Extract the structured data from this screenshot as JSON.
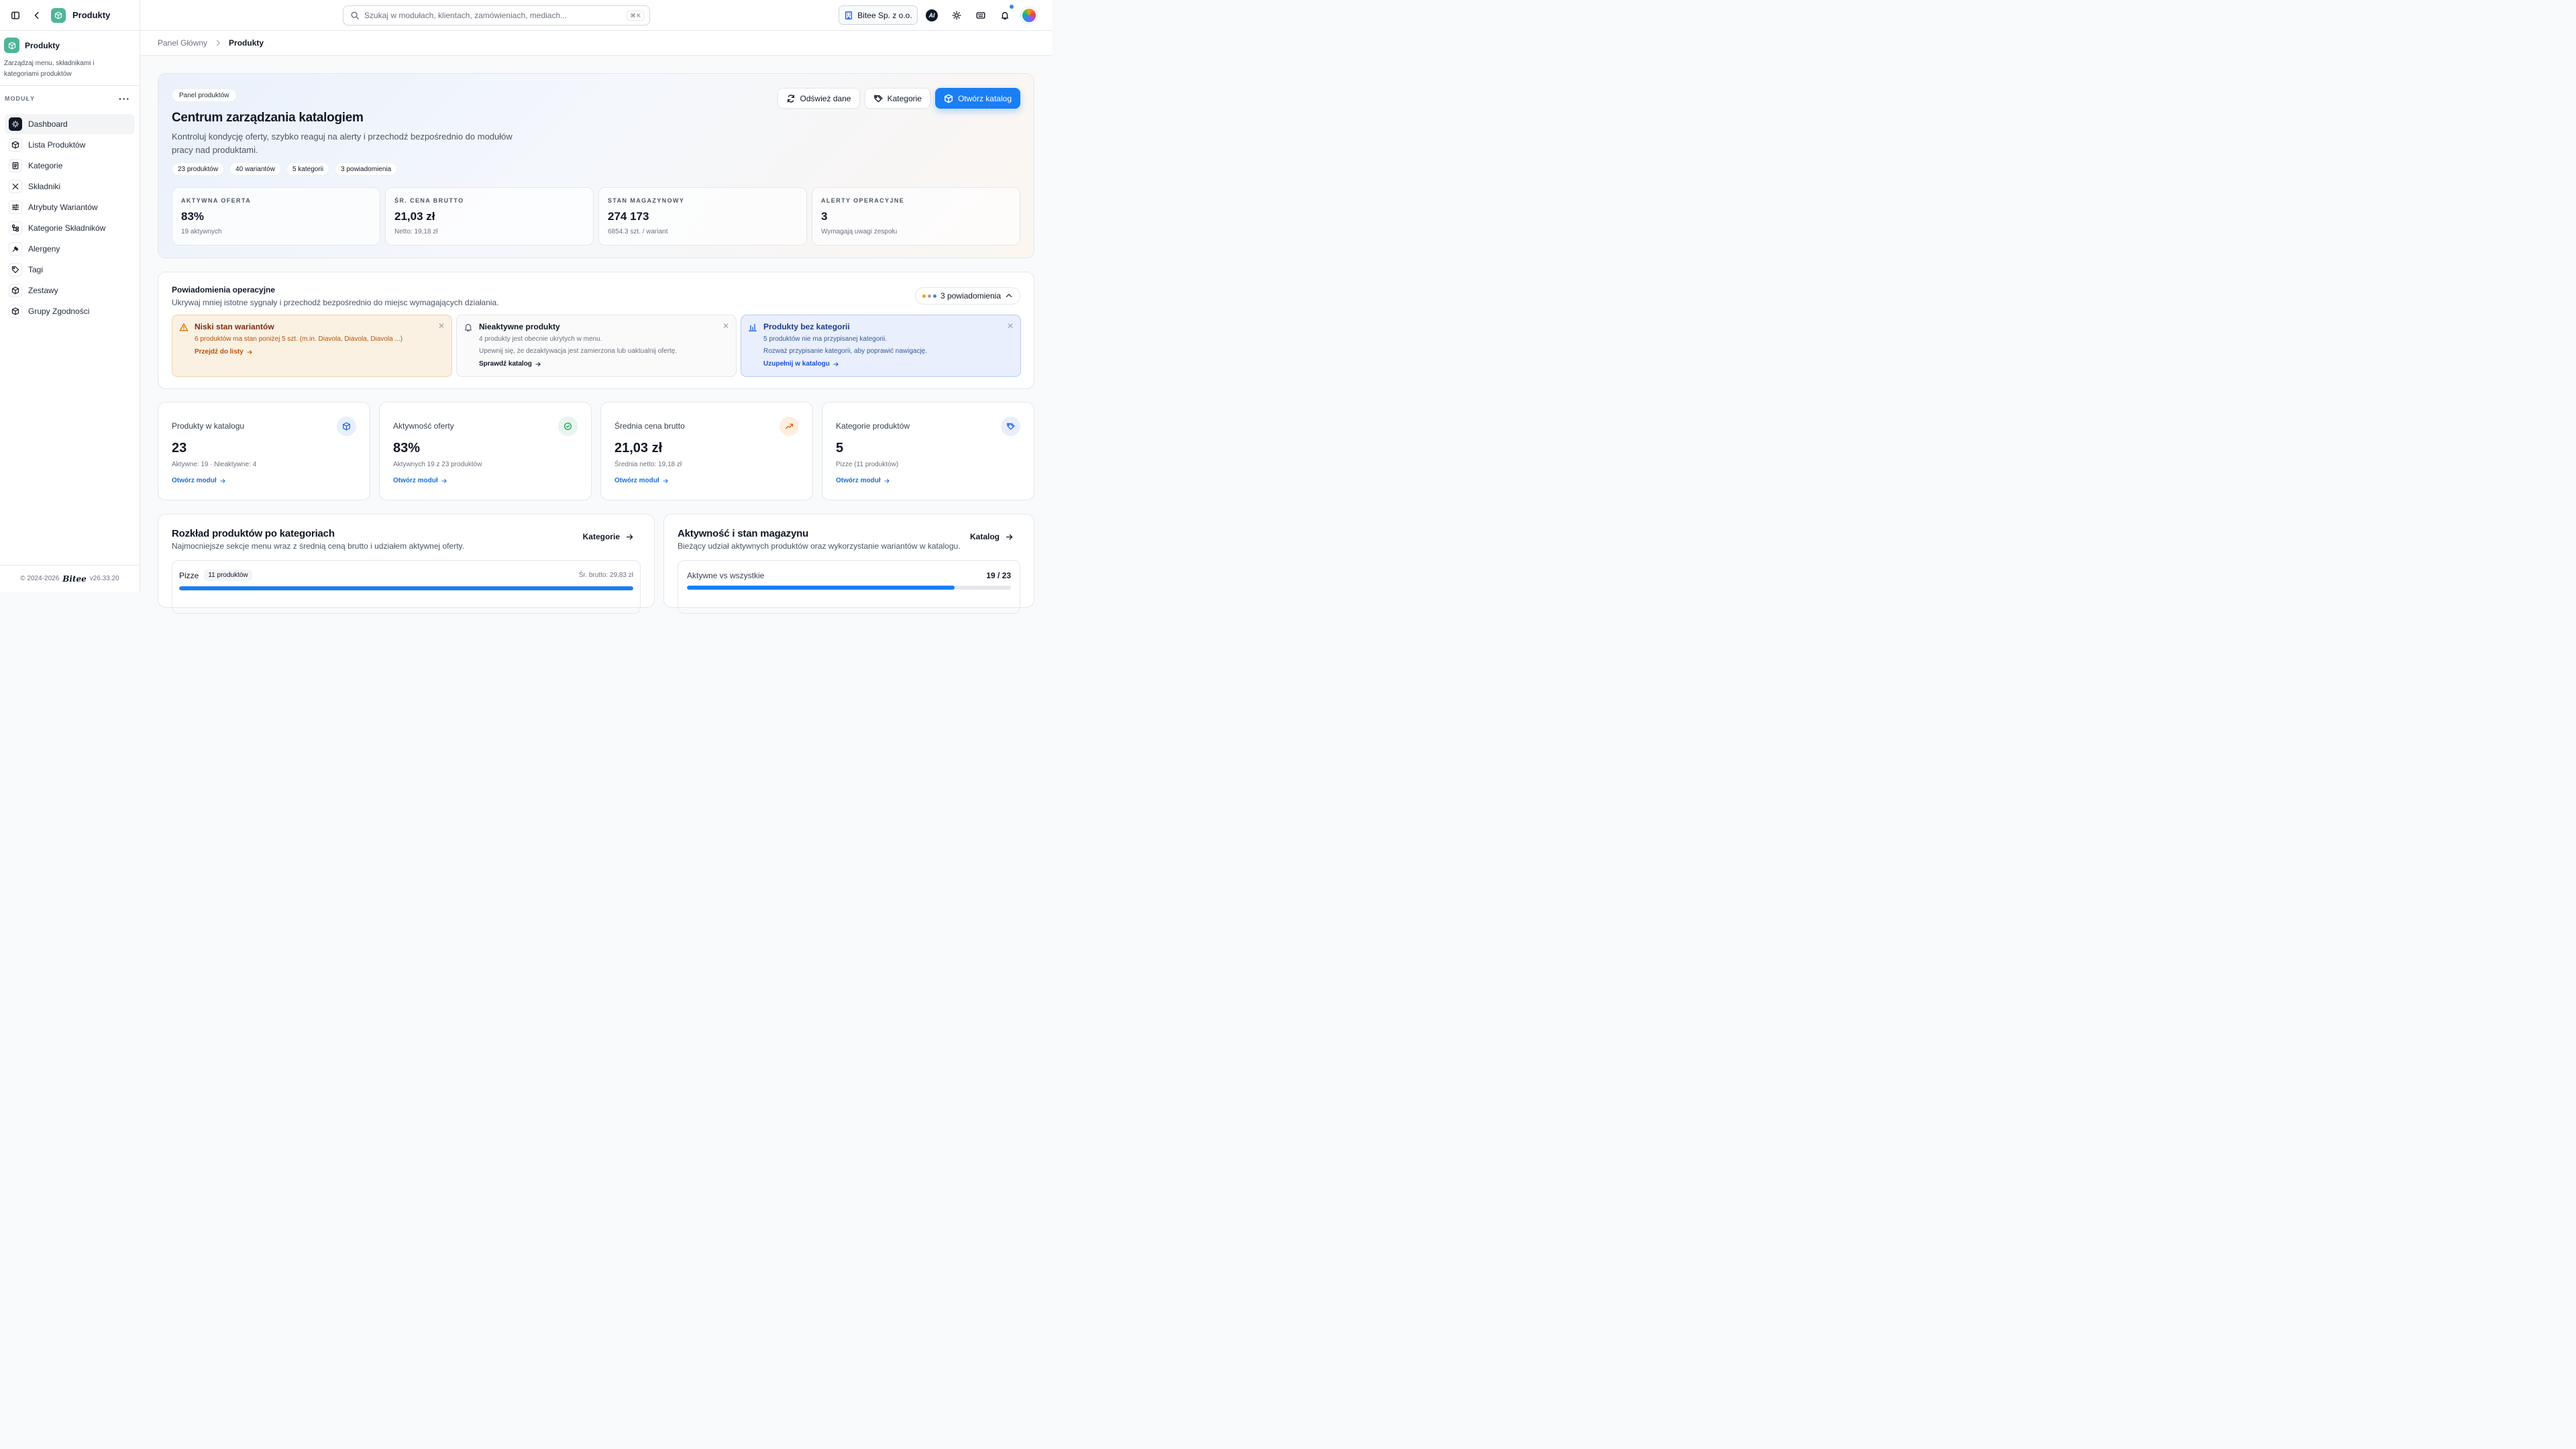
{
  "sidebar": {
    "app_title": "Produkty",
    "module_name": "Produkty",
    "module_desc": "Zarządzaj menu, składnikami i kategoriami produktów",
    "section_label": "MODUŁY",
    "items": [
      {
        "label": "Dashboard",
        "icon": "sparkle-icon"
      },
      {
        "label": "Lista Produktów",
        "icon": "box-icon"
      },
      {
        "label": "Kategorie",
        "icon": "document-icon"
      },
      {
        "label": "Składniki",
        "icon": "utensils-icon"
      },
      {
        "label": "Atrybuty Wariantów",
        "icon": "sliders-icon"
      },
      {
        "label": "Kategorie Składników",
        "icon": "tree-icon"
      },
      {
        "label": "Alergeny",
        "icon": "wheat-icon"
      },
      {
        "label": "Tagi",
        "icon": "tag-icon"
      },
      {
        "label": "Zestawy",
        "icon": "package-icon"
      },
      {
        "label": "Grupy Zgodności",
        "icon": "package-icon"
      }
    ],
    "footer": {
      "copyright": "© 2024-2026",
      "logo": "Bitee",
      "version": "v26.33.20"
    }
  },
  "topbar": {
    "search_placeholder": "Szukaj w modułach, klientach, zamówieniach, mediach...",
    "shortcut": "⌘ K",
    "company": "Bitee Sp. z o.o.",
    "ai_label": "AI"
  },
  "breadcrumb": {
    "root": "Panel Główny",
    "current": "Produkty"
  },
  "hero": {
    "pill": "Panel produktów",
    "title": "Centrum zarządzania katalogiem",
    "subtitle": "Kontroluj kondycję oferty, szybko reaguj na alerty i przechodź bezpośrednio do modułów pracy nad produktami.",
    "chips": [
      "23 produktów",
      "40 wariantów",
      "5 kategorii",
      "3 powiadomienia"
    ],
    "actions": {
      "refresh": "Odśwież dane",
      "categories": "Kategorie",
      "open_catalog": "Otwórz katalog"
    },
    "kpis": [
      {
        "label": "AKTYWNA OFERTA",
        "value": "83%",
        "note": "19 aktywnych"
      },
      {
        "label": "ŚR. CENA BRUTTO",
        "value": "21,03 zł",
        "note": "Netto: 19,18 zł"
      },
      {
        "label": "STAN MAGAZYNOWY",
        "value": "274 173",
        "note": "6854.3 szt. / wariant"
      },
      {
        "label": "ALERTY OPERACYJNE",
        "value": "3",
        "note": "Wymagają uwagi zespołu"
      }
    ]
  },
  "notifications": {
    "title": "Powiadomienia operacyjne",
    "subtitle": "Ukrywaj mniej istotne sygnały i przechodź bezpośrednio do miejsc wymagających działania.",
    "count_label": "3 powiadomienia",
    "dot_colors": [
      "#f59e0b",
      "#9ca3af",
      "#3b82f6"
    ],
    "cards": [
      {
        "title": "Niski stan wariantów",
        "lines": [
          "6 produktów ma stan poniżej 5 szt. (m.in. Diavola, Diavola, Diavola ...)"
        ],
        "link": "Przejdź do listy"
      },
      {
        "title": "Nieaktywne produkty",
        "lines": [
          "4 produkty jest obecnie ukrytych w menu.",
          "Upewnij się, że dezaktywacja jest zamierzona lub uaktualnij ofertę."
        ],
        "link": "Sprawdź katalog"
      },
      {
        "title": "Produkty bez kategorii",
        "lines": [
          "5 produktów nie ma przypisanej kategorii.",
          "Rozważ przypisanie kategorii, aby poprawić nawigację."
        ],
        "link": "Uzupełnij w katalogu"
      }
    ]
  },
  "stats": [
    {
      "label": "Produkty w katalogu",
      "value": "23",
      "note": "Aktywne: 19 · Nieaktywne: 4",
      "link": "Otwórz moduł",
      "icon_bg": "#e6f0fb",
      "icon_color": "#2563eb"
    },
    {
      "label": "Aktywność oferty",
      "value": "83%",
      "note": "Aktywnych 19 z 23 produktów",
      "link": "Otwórz moduł",
      "icon_bg": "#e7f5ee",
      "icon_color": "#16a34a"
    },
    {
      "label": "Średnia cena brutto",
      "value": "21,03 zł",
      "note": "Średnia netto: 19,18 zł",
      "link": "Otwórz moduł",
      "icon_bg": "#fdefe0",
      "icon_color": "#ea580c"
    },
    {
      "label": "Kategorie produktów",
      "value": "5",
      "note": "Pizze (11 produktów)",
      "link": "Otwórz moduł",
      "icon_bg": "#e8eefb",
      "icon_color": "#2563eb"
    }
  ],
  "distribution": {
    "title": "Rozkład produktów po kategoriach",
    "subtitle": "Najmocniejsze sekcje menu wraz z średnią ceną brutto i udziałem aktywnej oferty.",
    "link": "Kategorie",
    "rows": [
      {
        "name": "Pizze",
        "count": "11 produktów",
        "avg": "Śr. brutto: 29,83 zł",
        "share": 1.0
      }
    ]
  },
  "activity": {
    "title": "Aktywność i stan magazynu",
    "subtitle": "Bieżący udział aktywnych produktów oraz wykorzystanie wariantów w katalogu.",
    "link": "Katalog",
    "row": {
      "label": "Aktywne vs wszystkie",
      "value": "19 / 23",
      "share": 0.826
    }
  }
}
